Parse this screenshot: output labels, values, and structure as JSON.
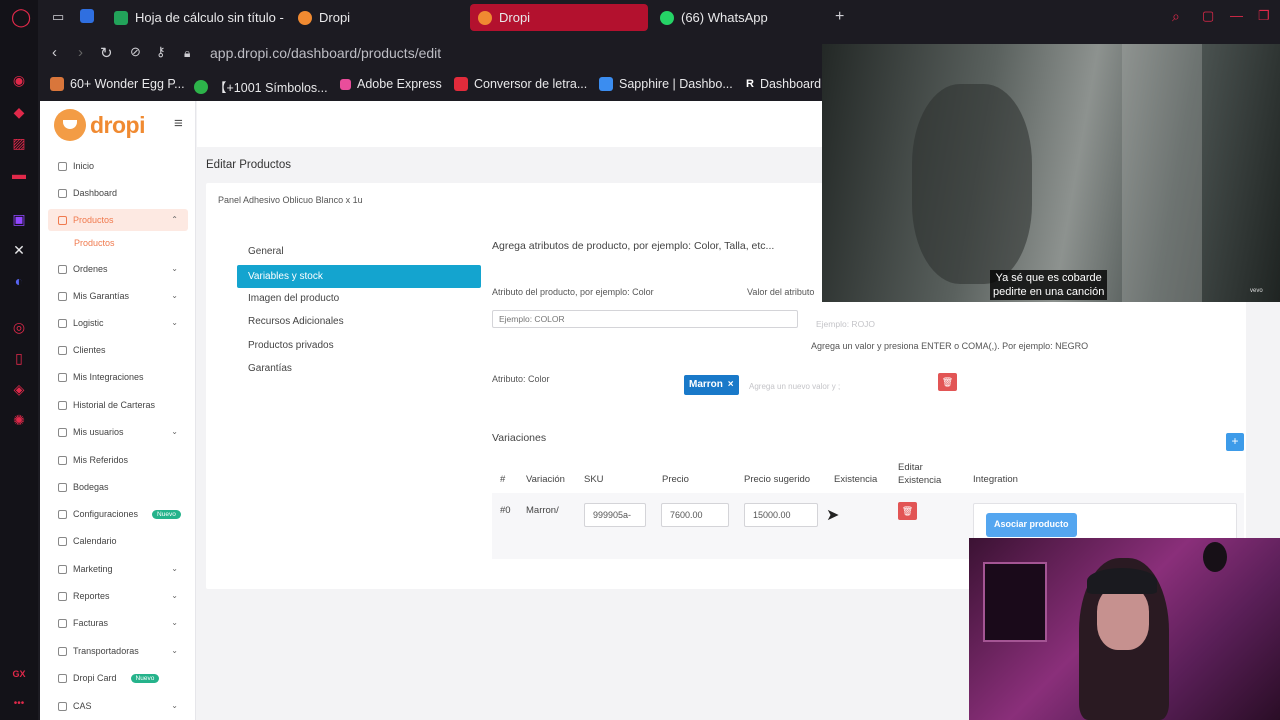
{
  "browser": {
    "tabs": [
      {
        "label": "Hoja de cálculo sin título -",
        "favicon_color": "#22a35a"
      },
      {
        "label": "Dropi",
        "favicon_color": "#f08a31"
      },
      {
        "label": "Dropi",
        "favicon_color": "#f08a31",
        "active": true
      },
      {
        "label": "(66) WhatsApp",
        "favicon_color": "#25d366"
      }
    ],
    "new_tab_icon": "+",
    "url": "app.dropi.co/dashboard/products/edit",
    "bookmarks": [
      {
        "label": "60+ Wonder Egg P...",
        "icon_color": "#d9763b"
      },
      {
        "label": "【+1001 Símbolos...",
        "icon_color": "#2db34a"
      },
      {
        "label": "Adobe Express",
        "icon_color": "#e94d9b"
      },
      {
        "label": "Conversor de letra...",
        "icon_color": "#e22b3b"
      },
      {
        "label": "Sapphire | Dashbo...",
        "icon_color": "#3b8df0"
      },
      {
        "label": "Dashboard",
        "icon_color": "#ffffff"
      }
    ],
    "rail_footer": "GX"
  },
  "app": {
    "logo_text": "dropi",
    "sidebar": {
      "items": [
        {
          "label": "Inicio",
          "chevron": false
        },
        {
          "label": "Dashboard",
          "chevron": false
        },
        {
          "label": "Productos",
          "chevron": true,
          "active": true
        },
        {
          "label": "Ordenes",
          "chevron": true
        },
        {
          "label": "Mis Garantías",
          "chevron": true
        },
        {
          "label": "Logistic",
          "chevron": true
        },
        {
          "label": "Clientes",
          "chevron": false
        },
        {
          "label": "Mis Integraciones",
          "chevron": false
        },
        {
          "label": "Historial de Carteras",
          "chevron": false
        },
        {
          "label": "Mis usuarios",
          "chevron": true
        },
        {
          "label": "Mis Referidos",
          "chevron": false
        },
        {
          "label": "Bodegas",
          "chevron": false
        },
        {
          "label": "Configuraciones",
          "badge": "Nuevo"
        },
        {
          "label": "Calendario",
          "chevron": false
        },
        {
          "label": "Marketing",
          "chevron": true
        },
        {
          "label": "Reportes",
          "chevron": true
        },
        {
          "label": "Facturas",
          "chevron": true
        },
        {
          "label": "Transportadoras",
          "chevron": true
        },
        {
          "label": "Dropi Card",
          "badge": "Nuevo"
        },
        {
          "label": "CAS",
          "chevron": true
        }
      ],
      "sub_item": "Productos"
    },
    "page_title": "Editar Productos",
    "product_name": "Panel Adhesivo Oblicuo Blanco x 1u",
    "left_menu": [
      "General",
      "Variables y stock",
      "Imagen del producto",
      "Recursos Adicionales",
      "Productos privados",
      "Garantías"
    ],
    "attributes": {
      "hint": "Agrega atributos de producto, por ejemplo: Color, Talla, etc...",
      "attr_label": "Atributo del producto, por ejemplo: Color",
      "attr_placeholder": "Ejemplo: COLOR",
      "value_label": "Valor del atributo",
      "value_placeholder": "Ejemplo: ROJO",
      "value_hint": "Agrega un valor y presiona ENTER o COMA(,). Por ejemplo: NEGRO",
      "current_attribute": "Atributo: Color",
      "chip": "Marron",
      "chip_remove": "×",
      "new_value_placeholder": "Agrega un nuevo valor y ;"
    },
    "variations": {
      "title": "Variaciones",
      "add_icon": "+",
      "headers": [
        "#",
        "Variación",
        "SKU",
        "Precio",
        "Precio sugerido",
        "Existencia",
        "Editar Existencia",
        "Integration"
      ],
      "row": {
        "index": "#0",
        "variation": "Marron/",
        "sku": "999905a-",
        "price": "7600.00",
        "suggested_price": "15000.00",
        "associate_button": "Asociar producto"
      }
    }
  },
  "overlay": {
    "subtitle_line1": "Ya sé que es cobarde",
    "subtitle_line2": "pedirte en una canción",
    "video_watermark": "vevo"
  }
}
